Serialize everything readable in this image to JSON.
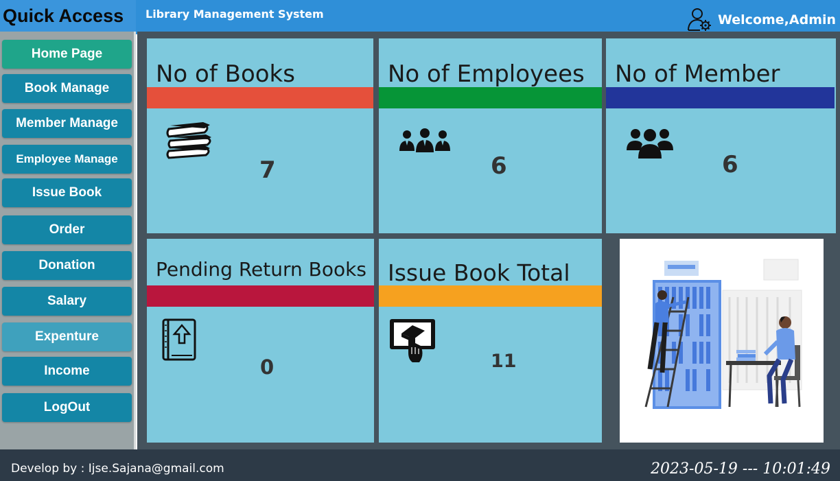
{
  "header": {
    "quick_access": "Quick Access",
    "app_title": "Library Management System",
    "welcome": "Welcome,Admin",
    "user_icon": "user-settings-icon"
  },
  "sidebar": {
    "items": [
      {
        "label": "Home Page"
      },
      {
        "label": "Book Manage"
      },
      {
        "label": "Member Manage"
      },
      {
        "label": "Employee Manage"
      },
      {
        "label": "Issue Book"
      },
      {
        "label": "Order"
      },
      {
        "label": "Donation"
      },
      {
        "label": "Salary"
      },
      {
        "label": "Expenture"
      },
      {
        "label": "Income"
      },
      {
        "label": "LogOut"
      }
    ]
  },
  "cards": {
    "books": {
      "title": "No of Books",
      "value": "7",
      "icon": "books-stack-icon",
      "accent": "#e5503b"
    },
    "employees": {
      "title": "No of Employees",
      "value": "6",
      "icon": "employees-group-icon",
      "accent": "#069537"
    },
    "members": {
      "title": "No of Member",
      "value": "6",
      "icon": "members-group-icon",
      "accent": "#22359a"
    },
    "pending": {
      "title": "Pending Return Books",
      "value": "0",
      "icon": "book-upload-icon",
      "accent": "#b9163d"
    },
    "issued": {
      "title": "Issue Book Total",
      "value": "11",
      "icon": "tablet-book-icon",
      "accent": "#f6a11f"
    }
  },
  "footer": {
    "developer": "Develop by : Ijse.Sajana@gmail.com",
    "datetime": "2023-05-19 --- 10:01:49"
  },
  "colors": {
    "topbar": "#2f8fd8",
    "sidebar_button": "#1486a6",
    "home_button": "#1fa58a",
    "card_bg": "#7ec9dd",
    "panel_bg": "#45535d",
    "footer_bg": "#2d3a47"
  }
}
